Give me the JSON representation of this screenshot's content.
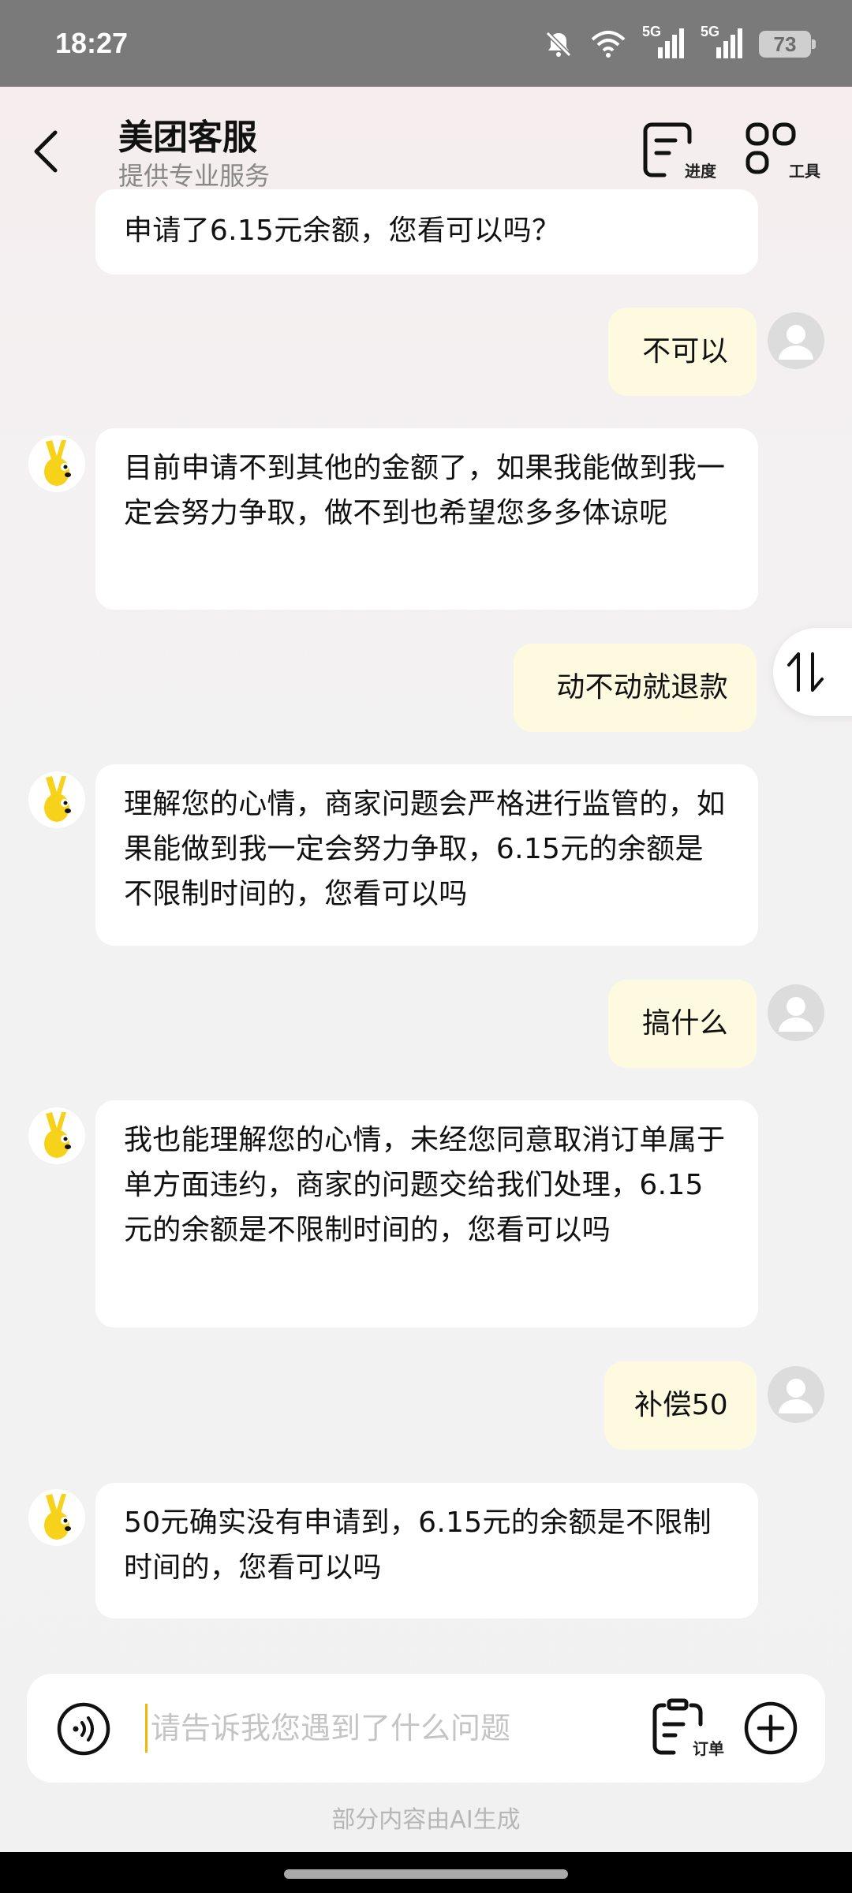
{
  "status_bar": {
    "time": "18:27",
    "network_1": "5G",
    "network_2": "5G",
    "battery": "73"
  },
  "header": {
    "title": "美团客服",
    "subtitle": "提供专业服务",
    "progress_label": "进度",
    "tools_label": "工具"
  },
  "messages": [
    {
      "from": "agent",
      "text": "申请了6.15元余额，您看可以吗？"
    },
    {
      "from": "user",
      "text": "不可以"
    },
    {
      "from": "agent",
      "text": "目前申请不到其他的金额了，如果我能做到我一定会努力争取，做不到也希望您多多体谅呢"
    },
    {
      "from": "user",
      "text": "动不动就退款"
    },
    {
      "from": "agent",
      "text": "理解您的心情，商家问题会严格进行监管的，如果能做到我一定会努力争取，6.15元的余额是不限制时间的，您看可以吗"
    },
    {
      "from": "user",
      "text": "搞什么"
    },
    {
      "from": "agent",
      "text": "我也能理解您的心情，未经您同意取消订单属于单方面违约，商家的问题交给我们处理，6.15元的余额是不限制时间的，您看可以吗"
    },
    {
      "from": "user",
      "text": "补偿50"
    },
    {
      "from": "agent",
      "text": "50元确实没有申请到，6.15元的余额是不限制时间的，您看可以吗"
    }
  ],
  "input": {
    "placeholder": "请告诉我您遇到了什么问题",
    "order_label": "订单"
  },
  "footer_note": "部分内容由AI生成",
  "colors": {
    "user_bubble": "#fdfae0",
    "agent_bubble": "#ffffff",
    "brand_yellow": "#f7d21a"
  }
}
